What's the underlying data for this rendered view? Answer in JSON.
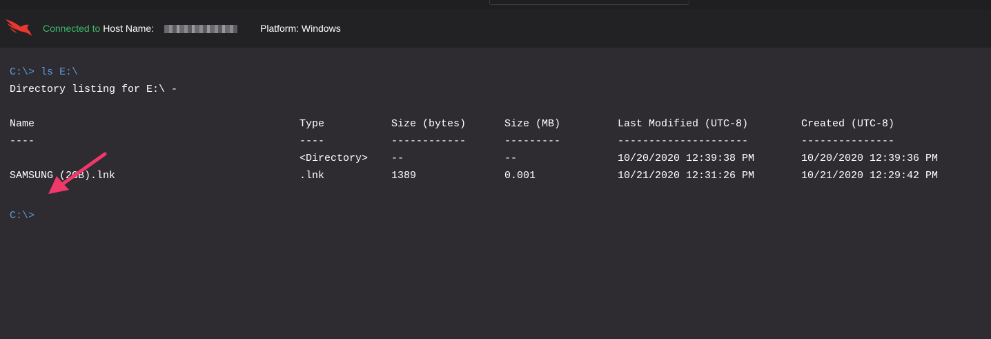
{
  "header": {
    "connected_label": "Connected to",
    "host_label": "Host Name:",
    "platform_text": "Platform: Windows"
  },
  "colors": {
    "connected_green": "#3dbc6e",
    "prompt_blue": "#5b9bd8",
    "logo_red": "#e8382f",
    "arrow_pink": "#f0386b",
    "terminal_bg": "#2e2c31",
    "header_bg": "#222123"
  },
  "terminal": {
    "command_line": "C:\\> ls E:\\",
    "listing_title": "Directory listing for E:\\ -",
    "columns": {
      "name": "Name",
      "type": "Type",
      "bytes": "Size (bytes)",
      "mb": "Size (MB)",
      "modified": "Last Modified (UTC-8)",
      "created": "Created (UTC-8)"
    },
    "separators": {
      "name": "----",
      "type": "----",
      "bytes": "------------",
      "mb": "---------",
      "modified": "---------------------",
      "created": "---------------"
    },
    "rows": [
      {
        "name": "",
        "type": "<Directory>",
        "bytes": "--",
        "mb": "--",
        "modified": "10/20/2020 12:39:38 PM",
        "created": "10/20/2020 12:39:36 PM"
      },
      {
        "name": "SAMSUNG (2GB).lnk",
        "type": ".lnk",
        "bytes": "1389",
        "mb": "0.001",
        "modified": "10/21/2020 12:31:26 PM",
        "created": "10/21/2020 12:29:42 PM"
      }
    ],
    "final_prompt": "C:\\>"
  },
  "icons": {
    "logo": "falcon-logo-icon",
    "annotation": "pink-arrow-annotation"
  }
}
